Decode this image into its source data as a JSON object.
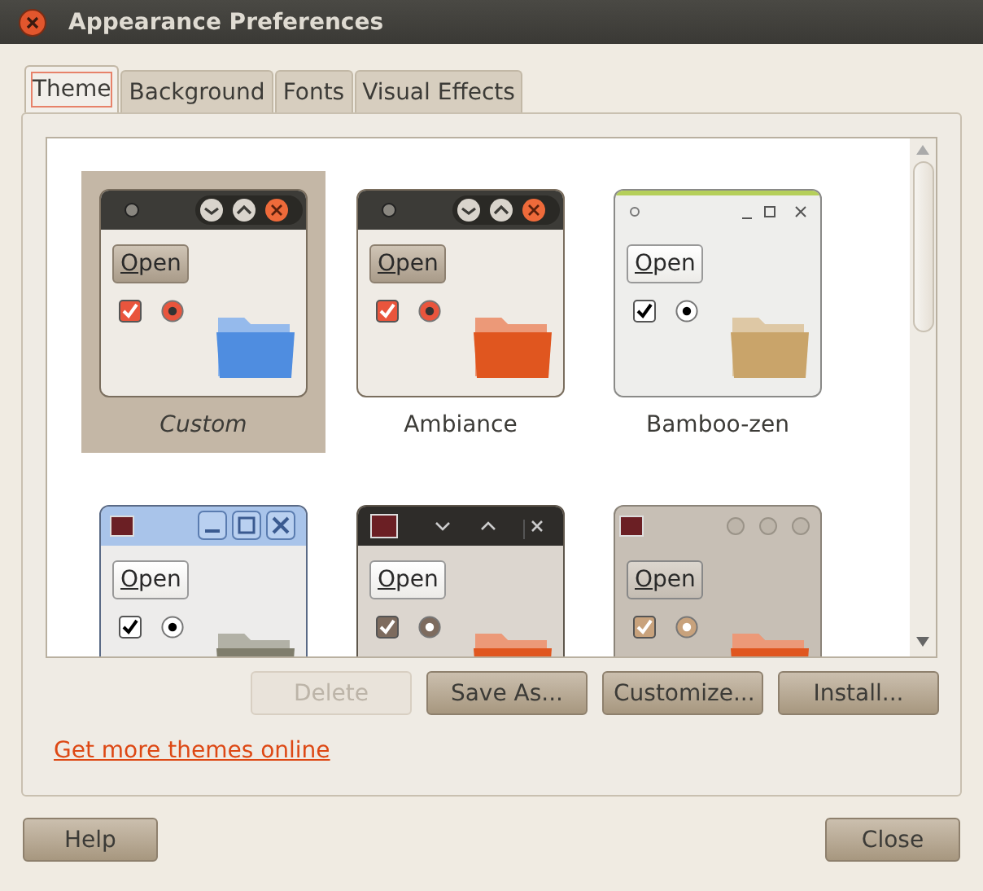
{
  "window": {
    "title": "Appearance Preferences"
  },
  "tabs": [
    {
      "label": "Theme",
      "selected": true
    },
    {
      "label": "Background",
      "selected": false
    },
    {
      "label": "Fonts",
      "selected": false
    },
    {
      "label": "Visual Effects",
      "selected": false
    }
  ],
  "themes": [
    {
      "name": "Custom",
      "selected": true,
      "custom": true,
      "kind": "ambiance",
      "color": "#4f8de0",
      "button": "Open"
    },
    {
      "name": "Ambiance",
      "selected": false,
      "custom": false,
      "kind": "ambiance",
      "color": "#e0561f",
      "button": "Open"
    },
    {
      "name": "Bamboo-zen",
      "selected": false,
      "custom": false,
      "kind": "bamboo",
      "color": "#c9a46a",
      "button": "Open"
    },
    {
      "selected": false,
      "kind": "blue",
      "color": "#7f7d6c",
      "button": "Open"
    },
    {
      "selected": false,
      "kind": "dark",
      "color": "#e0561f",
      "button": "Open"
    },
    {
      "selected": false,
      "kind": "taupe",
      "color": "#e0561f",
      "button": "Open"
    }
  ],
  "actions": [
    {
      "label": "Delete",
      "disabled": true
    },
    {
      "label": "Save As...",
      "disabled": false
    },
    {
      "label": "Customize...",
      "disabled": false
    },
    {
      "label": "Install...",
      "disabled": false
    }
  ],
  "link": "Get more themes online",
  "footer": {
    "help": "Help",
    "close": "Close"
  }
}
